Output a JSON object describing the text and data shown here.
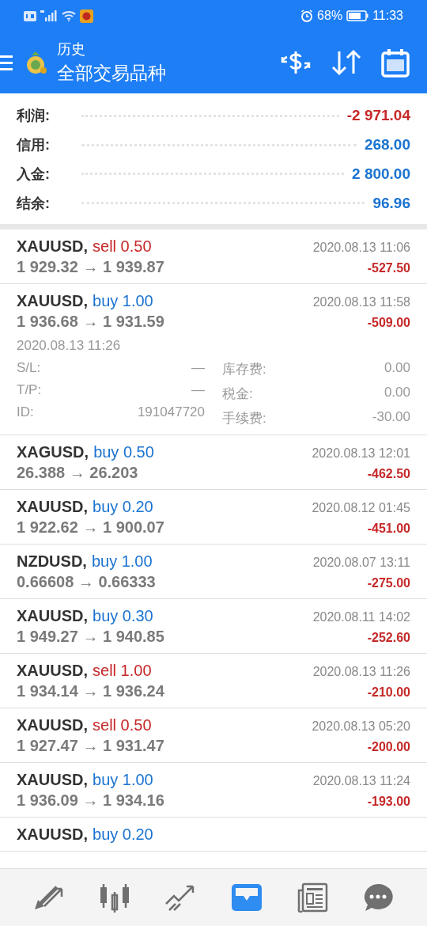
{
  "status_bar": {
    "battery_text": "68%",
    "time": "11:33"
  },
  "header": {
    "title": "历史",
    "subtitle": "全部交易品种"
  },
  "summary": [
    {
      "label": "利润:",
      "value": "-2 971.04",
      "loss": true
    },
    {
      "label": "信用:",
      "value": "268.00",
      "loss": false
    },
    {
      "label": "入金:",
      "value": "2 800.00",
      "loss": false
    },
    {
      "label": "结余:",
      "value": "96.96",
      "loss": false
    }
  ],
  "deals": [
    {
      "symbol": "XAUUSD,",
      "kind": "sell",
      "side": "sell",
      "volume": "0.50",
      "prices": "1 929.32 → 1 939.87",
      "time": "2020.08.13 11:06",
      "profit": "-527.50",
      "loss": true
    },
    {
      "symbol": "XAUUSD,",
      "kind": "buy",
      "side": "buy",
      "volume": "1.00",
      "prices": "1 936.68 → 1 931.59",
      "time": "2020.08.13 11:58",
      "profit": "-509.00",
      "loss": true,
      "details": {
        "open_time": "2020.08.13 11:26",
        "left": [
          {
            "label": "S/L:",
            "value": "—"
          },
          {
            "label": "T/P:",
            "value": "—"
          },
          {
            "label": "ID:",
            "value": "191047720"
          }
        ],
        "right": [
          {
            "label": "库存费:",
            "value": "0.00"
          },
          {
            "label": "税金:",
            "value": "0.00"
          },
          {
            "label": "手续费:",
            "value": "-30.00"
          }
        ]
      }
    },
    {
      "symbol": "XAGUSD,",
      "kind": "buy",
      "side": "buy",
      "volume": "0.50",
      "prices": "26.388 → 26.203",
      "time": "2020.08.13 12:01",
      "profit": "-462.50",
      "loss": true
    },
    {
      "symbol": "XAUUSD,",
      "kind": "buy",
      "side": "buy",
      "volume": "0.20",
      "prices": "1 922.62 → 1 900.07",
      "time": "2020.08.12 01:45",
      "profit": "-451.00",
      "loss": true
    },
    {
      "symbol": "NZDUSD,",
      "kind": "buy",
      "side": "buy",
      "volume": "1.00",
      "prices": "0.66608 → 0.66333",
      "time": "2020.08.07 13:11",
      "profit": "-275.00",
      "loss": true
    },
    {
      "symbol": "XAUUSD,",
      "kind": "buy",
      "side": "buy",
      "volume": "0.30",
      "prices": "1 949.27 → 1 940.85",
      "time": "2020.08.11 14:02",
      "profit": "-252.60",
      "loss": true
    },
    {
      "symbol": "XAUUSD,",
      "kind": "sell",
      "side": "sell",
      "volume": "1.00",
      "prices": "1 934.14 → 1 936.24",
      "time": "2020.08.13 11:26",
      "profit": "-210.00",
      "loss": true
    },
    {
      "symbol": "XAUUSD,",
      "kind": "sell",
      "side": "sell",
      "volume": "0.50",
      "prices": "1 927.47 → 1 931.47",
      "time": "2020.08.13 05:20",
      "profit": "-200.00",
      "loss": true
    },
    {
      "symbol": "XAUUSD,",
      "kind": "buy",
      "side": "buy",
      "volume": "1.00",
      "prices": "1 936.09 → 1 934.16",
      "time": "2020.08.13 11:24",
      "profit": "-193.00",
      "loss": true
    },
    {
      "symbol": "XAUUSD,",
      "kind": "buy",
      "side": "buy",
      "volume": "0.20"
    }
  ],
  "nav": [
    {
      "kind": "quotes",
      "selected": false
    },
    {
      "kind": "chart",
      "selected": false
    },
    {
      "kind": "trade",
      "selected": false
    },
    {
      "kind": "history",
      "selected": true
    },
    {
      "kind": "news",
      "selected": false
    },
    {
      "kind": "chat",
      "selected": false
    }
  ]
}
